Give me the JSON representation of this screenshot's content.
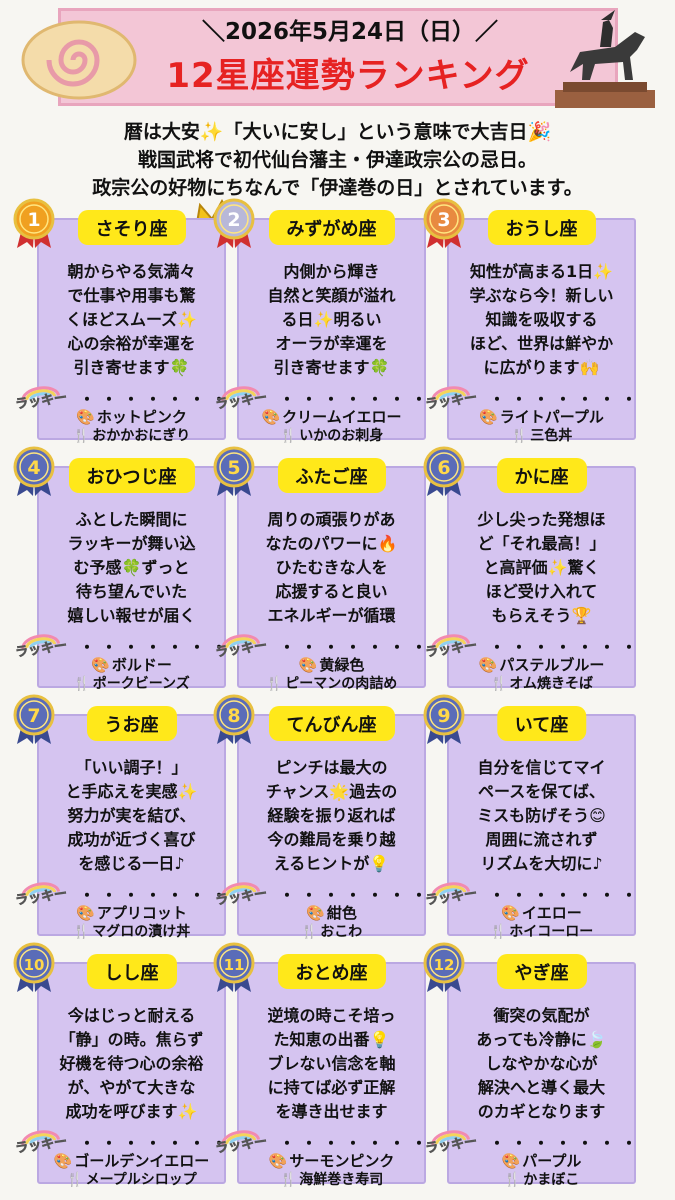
{
  "header": {
    "date_text": "＼2026年5月24日（日）／",
    "title": "12星座運勢ランキング"
  },
  "intro": [
    "暦は大安✨「大いに安し」という意味で大吉日🎉",
    "戦国武将で初代仙台藩主・伊達政宗公の忌日。",
    "政宗公の好物にちなんで「伊達巻の日」とされています。"
  ],
  "lucky_label": "ラッキー",
  "dots": "・・・・・・・",
  "icons": {
    "color": "palette-icon",
    "food": "chopsticks-icon"
  },
  "colors": {
    "card_bg": "#d5c4f0",
    "sign_bg": "#ffe81a",
    "title": "#e62222",
    "header_bg": "#f3c6d6"
  },
  "rankings": [
    {
      "rank": "1",
      "sign": "さそり座",
      "message": [
        "朝からやる気満々",
        "で仕事や用事も驚",
        "くほどスムーズ✨",
        "心の余裕が幸運を",
        "引き寄せます🍀"
      ],
      "color": "ホットピンク",
      "food": "おかかおにぎり"
    },
    {
      "rank": "2",
      "sign": "みずがめ座",
      "message": [
        "内側から輝き",
        "自然と笑顔が溢れ",
        "る日✨明るい",
        "オーラが幸運を",
        "引き寄せます🍀"
      ],
      "color": "クリームイエロー",
      "food": "いかのお刺身"
    },
    {
      "rank": "3",
      "sign": "おうし座",
      "message": [
        "知性が高まる1日✨",
        "学ぶなら今！新しい",
        "知識を吸収する",
        "ほど、世界は鮮やか",
        "に広がります🙌"
      ],
      "color": "ライトパープル",
      "food": "三色丼"
    },
    {
      "rank": "4",
      "sign": "おひつじ座",
      "message": [
        "ふとした瞬間に",
        "ラッキーが舞い込",
        "む予感🍀ずっと",
        "待ち望んでいた",
        "嬉しい報せが届く"
      ],
      "color": "ボルドー",
      "food": "ポークビーンズ"
    },
    {
      "rank": "5",
      "sign": "ふたご座",
      "message": [
        "周りの頑張りがあ",
        "なたのパワーに🔥",
        "ひたむきな人を",
        "応援すると良い",
        "エネルギーが循環"
      ],
      "color": "黄緑色",
      "food": "ピーマンの肉詰め"
    },
    {
      "rank": "6",
      "sign": "かに座",
      "message": [
        "少し尖った発想ほ",
        "ど「それ最高！」",
        "と高評価✨驚く",
        "ほど受け入れて",
        "もらえそう🏆"
      ],
      "color": "パステルブルー",
      "food": "オム焼きそば"
    },
    {
      "rank": "7",
      "sign": "うお座",
      "message": [
        "「いい調子！」",
        "と手応えを実感✨",
        "努力が実を結び、",
        "成功が近づく喜び",
        "を感じる一日♪"
      ],
      "color": "アプリコット",
      "food": "マグロの漬け丼"
    },
    {
      "rank": "8",
      "sign": "てんびん座",
      "message": [
        "ピンチは最大の",
        "チャンス🌟過去の",
        "経験を振り返れば",
        "今の難局を乗り越",
        "えるヒントが💡"
      ],
      "color": "紺色",
      "food": "おこわ"
    },
    {
      "rank": "9",
      "sign": "いて座",
      "message": [
        "自分を信じてマイ",
        "ペースを保てば、",
        "ミスも防げそう😊",
        "周囲に流されず",
        "リズムを大切に♪"
      ],
      "color": "イエロー",
      "food": "ホイコーロー"
    },
    {
      "rank": "10",
      "sign": "しし座",
      "message": [
        "今はじっと耐える",
        "「静」の時。焦らず",
        "好機を待つ心の余裕",
        "が、やがて大きな",
        "成功を呼びます✨"
      ],
      "color": "ゴールデンイエロー",
      "food": "メープルシロップ"
    },
    {
      "rank": "11",
      "sign": "おとめ座",
      "message": [
        "逆境の時こそ培っ",
        "た知恵の出番💡",
        "ブレない信念を軸",
        "に持てば必ず正解",
        "を導き出せます"
      ],
      "color": "サーモンピンク",
      "food": "海鮮巻き寿司"
    },
    {
      "rank": "12",
      "sign": "やぎ座",
      "message": [
        "衝突の気配が",
        "あっても冷静に🍃",
        "しなやかな心が",
        "解決へと導く最大",
        "のカギとなります"
      ],
      "color": "パープル",
      "food": "かまぼこ"
    }
  ]
}
